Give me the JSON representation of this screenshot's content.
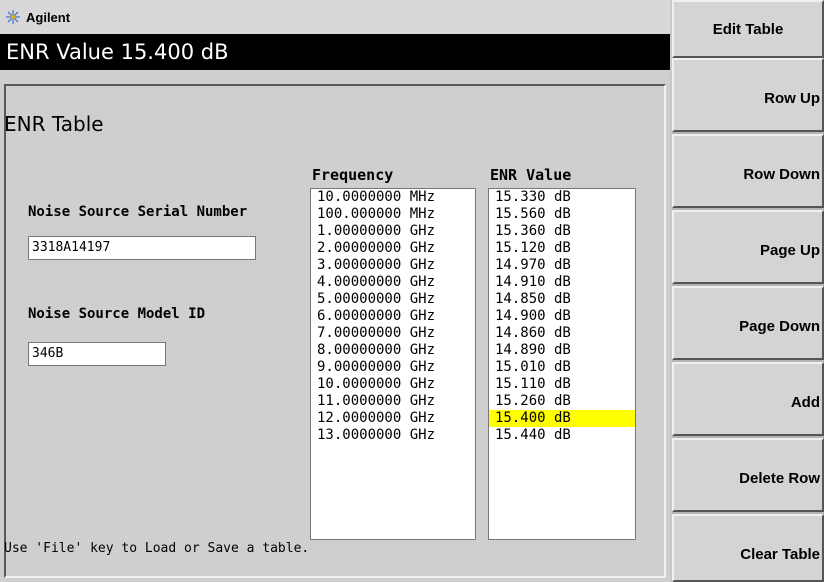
{
  "header": {
    "brand": "Agilent",
    "active_entry": "ENR Value 15.400 dB"
  },
  "panel": {
    "title": "ENR Table",
    "serial": {
      "label": "Noise Source Serial Number",
      "value": "3318A14197"
    },
    "model": {
      "label": "Noise Source Model ID",
      "value": "346B"
    },
    "columns": {
      "frequency": "Frequency",
      "enr": "ENR Value"
    },
    "rows": [
      {
        "freq": "10.0000000 MHz",
        "enr": "15.330 dB"
      },
      {
        "freq": "100.000000 MHz",
        "enr": "15.560 dB"
      },
      {
        "freq": "1.00000000 GHz",
        "enr": "15.360 dB"
      },
      {
        "freq": "2.00000000 GHz",
        "enr": "15.120 dB"
      },
      {
        "freq": "3.00000000 GHz",
        "enr": "14.970 dB"
      },
      {
        "freq": "4.00000000 GHz",
        "enr": "14.910 dB"
      },
      {
        "freq": "5.00000000 GHz",
        "enr": "14.850 dB"
      },
      {
        "freq": "6.00000000 GHz",
        "enr": "14.900 dB"
      },
      {
        "freq": "7.00000000 GHz",
        "enr": "14.860 dB"
      },
      {
        "freq": "8.00000000 GHz",
        "enr": "14.890 dB"
      },
      {
        "freq": "9.00000000 GHz",
        "enr": "15.010 dB"
      },
      {
        "freq": "10.0000000 GHz",
        "enr": "15.110 dB"
      },
      {
        "freq": "11.0000000 GHz",
        "enr": "15.260 dB"
      },
      {
        "freq": "12.0000000 GHz",
        "enr": "15.400 dB"
      },
      {
        "freq": "13.0000000 GHz",
        "enr": "15.440 dB"
      }
    ],
    "selected_row": 13,
    "selection_color": "#ffff00",
    "hint": "Use 'File' key to Load or Save a table."
  },
  "softkeys": {
    "title": "Edit Table",
    "keys": [
      {
        "label": "Row Up"
      },
      {
        "label": "Row Down"
      },
      {
        "label": "Page Up"
      },
      {
        "label": "Page Down"
      },
      {
        "label": "Add"
      },
      {
        "label": "Delete Row"
      },
      {
        "label": "Clear Table"
      }
    ]
  }
}
